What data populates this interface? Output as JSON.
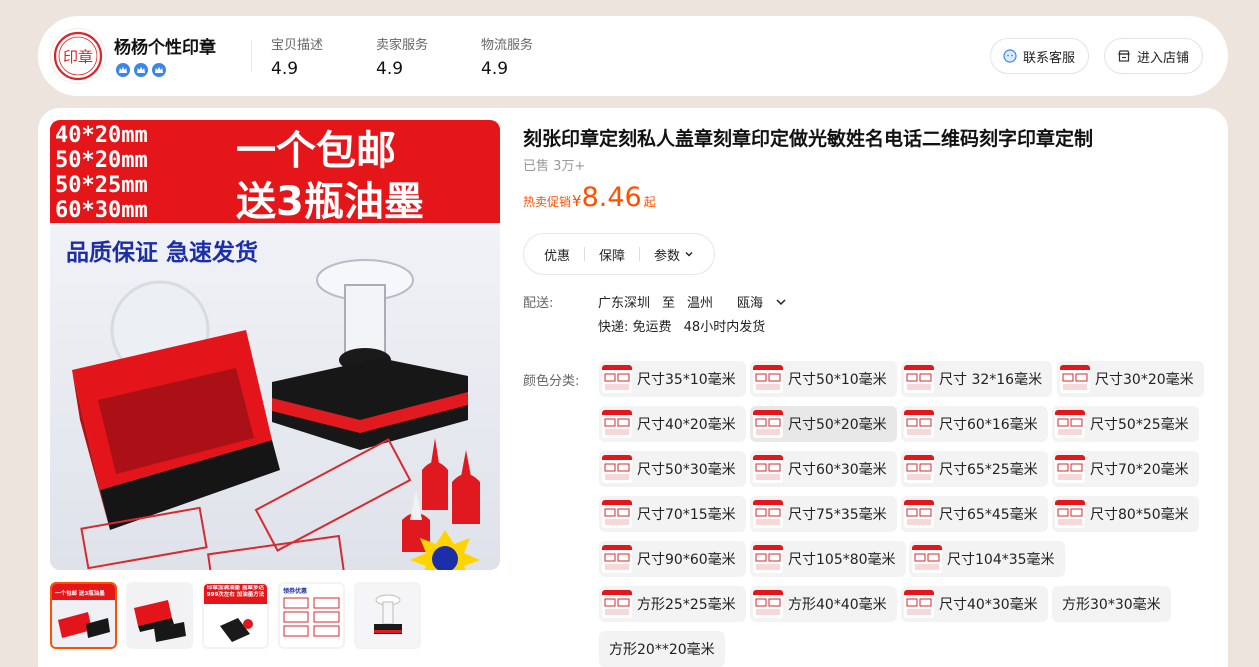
{
  "shop": {
    "name": "杨杨个性印章",
    "logo_text": "印章",
    "badge_icons": [
      "crown-badge-icon",
      "crown-badge-icon",
      "crown-badge-icon"
    ],
    "scores": [
      {
        "label": "宝贝描述",
        "value": "4.9"
      },
      {
        "label": "卖家服务",
        "value": "4.9"
      },
      {
        "label": "物流服务",
        "value": "4.9"
      }
    ],
    "contact_label": "联系客服",
    "enter_label": "进入店铺"
  },
  "main_image": {
    "sizes": [
      "40*20mm",
      "50*20mm",
      "50*25mm",
      "60*30mm"
    ],
    "headline1": "一个包邮",
    "headline2": "送3瓶油墨",
    "slogan": "品质保证 急速发货"
  },
  "thumbnails": [
    {
      "text": "一个包邮 送3瓶油墨",
      "active": true
    },
    {
      "text": "",
      "active": false
    },
    {
      "text": "印章加满油墨 盖章多达999次左右 加油墨方法",
      "active": false
    },
    {
      "text": "领券优惠",
      "active": false
    },
    {
      "text": "",
      "active": false
    }
  ],
  "product": {
    "title": "刻张印章定刻私人盖章刻章印定做光敏姓名电话二维码刻字印章定制",
    "sold": "已售 3万+",
    "price_tag": "热卖促销",
    "currency": "¥",
    "price": "8.46",
    "price_suffix": "起"
  },
  "tabs": [
    "优惠",
    "保障",
    "参数"
  ],
  "shipping": {
    "label": "配送:",
    "from": "广东深圳",
    "to_word": "至",
    "city": "温州",
    "district": "瓯海",
    "express_label": "快递: 免运费",
    "delivery": "48小时内发货"
  },
  "options": {
    "label": "颜色分类:",
    "selected": "尺寸50*20毫米",
    "items": [
      "尺寸35*10毫米",
      "尺寸50*10毫米",
      "尺寸 32*16毫米",
      "尺寸30*20毫米",
      "尺寸40*20毫米",
      "尺寸50*20毫米",
      "尺寸60*16毫米",
      "尺寸50*25毫米",
      "尺寸50*30毫米",
      "尺寸60*30毫米",
      "尺寸65*25毫米",
      "尺寸70*20毫米",
      "尺寸70*15毫米",
      "尺寸75*35毫米",
      "尺寸65*45毫米",
      "尺寸80*50毫米",
      "尺寸90*60毫米",
      "尺寸105*80毫米",
      "尺寸104*35毫米",
      "方形25*25毫米",
      "方形40*40毫米",
      "尺寸40*30毫米",
      "方形30*30毫米",
      "方形20**20毫米"
    ]
  },
  "colors": {
    "accent": "#ff5000",
    "banner_red": "#e5161a",
    "slogan_blue": "#1d2fa8",
    "page_bg": "#ece4dd"
  }
}
